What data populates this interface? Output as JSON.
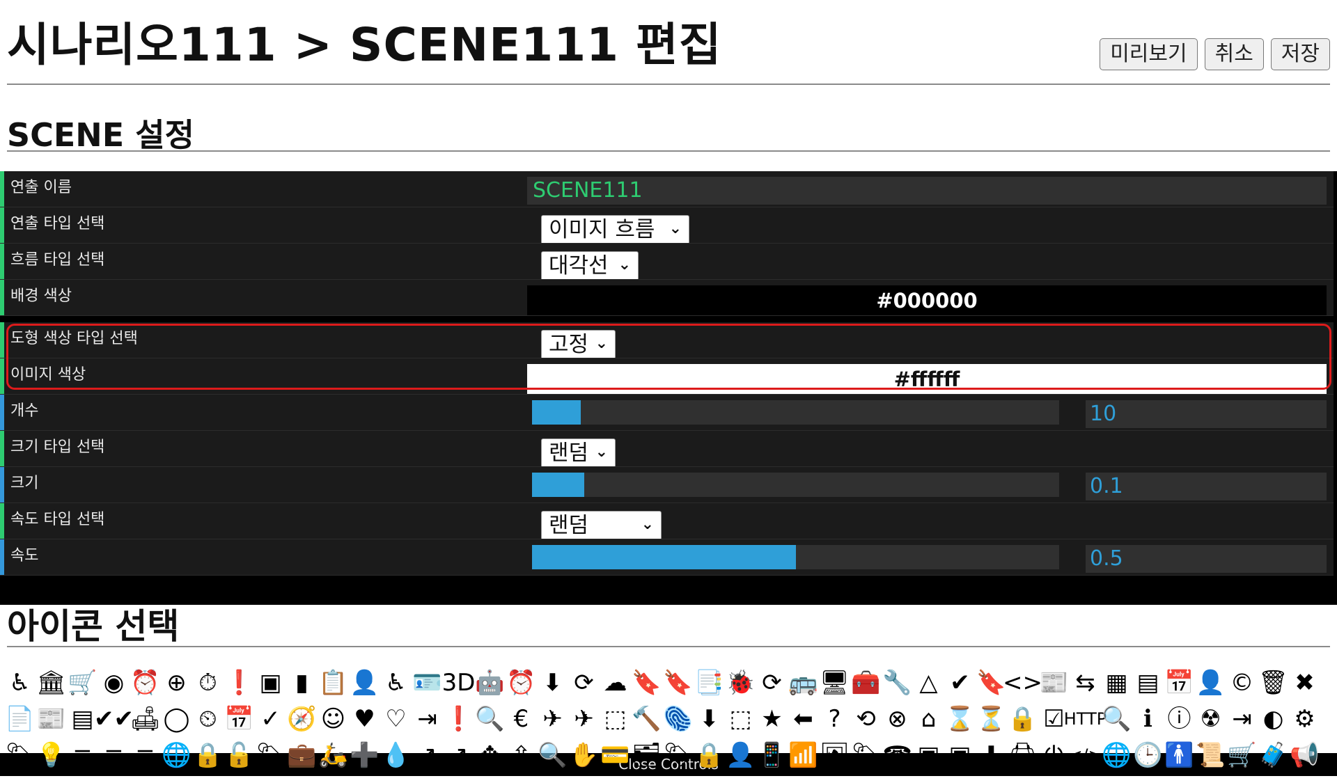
{
  "header": {
    "title": "시나리오111 > SCENE111 편집",
    "buttons": {
      "preview": "미리보기",
      "cancel": "취소",
      "save": "저장"
    }
  },
  "scene_section": {
    "title": "SCENE 설정"
  },
  "controls": {
    "rows": [
      {
        "key": "name",
        "label": "연출 이름",
        "value": "SCENE111"
      },
      {
        "key": "effect_type",
        "label": "연출 타입 선택",
        "value": "이미지 흐름"
      },
      {
        "key": "flow_type",
        "label": "흐름 타입 선택",
        "value": "대각선"
      },
      {
        "key": "background_color",
        "label": "배경 색상",
        "value": "#000000"
      },
      {
        "key": "shape_color_type",
        "label": "도형 색상 타입 선택",
        "value": "고정"
      },
      {
        "key": "image_color",
        "label": "이미지 색상",
        "value": "#ffffff"
      },
      {
        "key": "count",
        "label": "개수",
        "value": "10",
        "fill_fraction": 0.093
      },
      {
        "key": "size_type",
        "label": "크기 타입 선택",
        "value": "랜덤"
      },
      {
        "key": "size",
        "label": "크기",
        "value": "0.1",
        "fill_fraction": 0.099
      },
      {
        "key": "speed_type",
        "label": "속도 타입 선택",
        "value": "랜덤"
      },
      {
        "key": "speed",
        "label": "속도",
        "value": "0.5",
        "fill_fraction": 0.5
      }
    ],
    "close_label": "Close Controls",
    "accent_colors": {
      "green": "#2ecc71",
      "blue": "#2f9fd8",
      "highlight": "#dd1b1b"
    }
  },
  "icons_section": {
    "title": "아이콘 선택",
    "rows": [
      [
        "♿",
        "🏛",
        "🛒",
        "◉",
        "⏰",
        "⊕",
        "⏱",
        "❗",
        "▣",
        "▮",
        "📋",
        "👤",
        "♿",
        "🪪",
        "3D",
        "🤖",
        "⏰",
        "⬇",
        "⟳",
        "☁",
        "🔖",
        "🔖",
        "📑",
        "🐞",
        "⟳",
        "🚌",
        "🖥",
        "🧰",
        "🔧",
        "△",
        "✔",
        "🔖",
        "<>",
        "📰",
        "⇆",
        "▦",
        "▤",
        "📅",
        "👤",
        "©",
        "🗑",
        "✖"
      ],
      [
        "📄",
        "📰",
        "▤",
        "✔✔",
        "🛋",
        "◯",
        "⏲",
        "📅",
        "✓",
        "🧭",
        "☺",
        "♥",
        "♡",
        "⇥",
        "❗",
        "🔍",
        "€",
        "✈",
        "✈",
        "⬚",
        "🔨",
        "🫆",
        "⬇",
        "⬚",
        "★",
        "⬅",
        "?",
        "⟲",
        "⊗",
        "⌂",
        "⌛",
        "⏳",
        "🔒",
        "☑",
        "HTTP",
        "🔍",
        "ℹ",
        "ⓘ",
        "☢",
        "⇥",
        "◐",
        "⚙"
      ],
      [
        "🏷",
        "💡",
        "≡",
        "≡",
        "≡",
        "🌐",
        "🔒",
        "🔓",
        "🏷",
        "💼",
        "🛵",
        "➕",
        "💧",
        "↗",
        "↗",
        "✥",
        "⇪",
        "🔍",
        "✋",
        "💳",
        "🗂",
        "🏷",
        "🔒",
        "👤",
        "📱",
        "📶",
        "🖼",
        "🏷",
        "☎",
        "▣",
        "▣",
        "⬇",
        "🖨",
        "⏻",
        "</>",
        "🌐",
        "🕒",
        "🚹",
        "📜",
        "🛒",
        "🧳",
        "📢"
      ]
    ]
  }
}
